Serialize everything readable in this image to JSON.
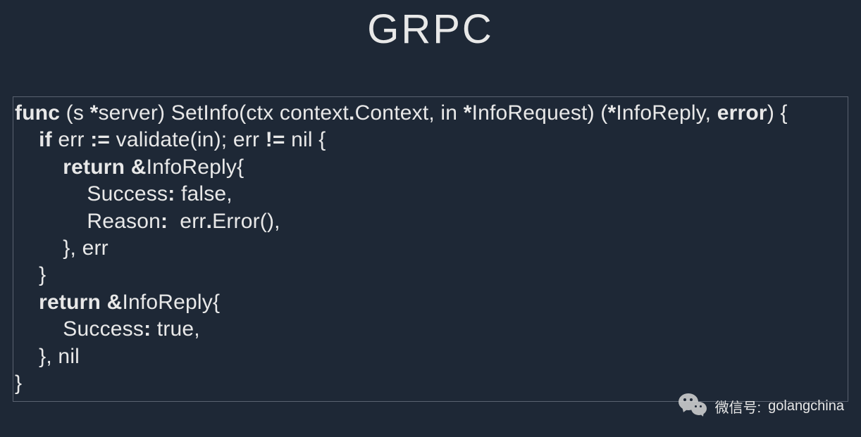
{
  "title": "GRPC",
  "code": {
    "line1": {
      "kw_func": "func",
      "receiver_open": " (s ",
      "star1": "*",
      "receiver_type": "server) SetInfo(ctx context",
      "dot1": ".",
      "context": "Context, in ",
      "star2": "*",
      "req": "InfoRequest) (",
      "star3": "*",
      "reply": "InfoReply, ",
      "kw_error": "error",
      "close": ") {"
    },
    "line2": {
      "indent": "    ",
      "kw_if": "if",
      "err": " err ",
      "op_assign": ":=",
      "validate": " validate(in); err ",
      "op_neq": "!=",
      "nil": " nil {"
    },
    "line3": {
      "indent": "        ",
      "kw_return": "return",
      "sp": " ",
      "amp": "&",
      "reply": "InfoReply{"
    },
    "line4": {
      "indent": "            Success",
      "colon": ":",
      "val": " false,"
    },
    "line5": {
      "indent": "            Reason",
      "colon": ":",
      "sp": "  err",
      "dot": ".",
      "call": "Error(),"
    },
    "line6": "        }, err",
    "line7": "    }",
    "line8": {
      "indent": "    ",
      "kw_return": "return",
      "sp": " ",
      "amp": "&",
      "reply": "InfoReply{"
    },
    "line9": {
      "indent": "        Success",
      "colon": ":",
      "val": " true,"
    },
    "line10": "    }, nil",
    "line11": "}"
  },
  "watermark": {
    "label": "微信号: ",
    "value": "golangchina"
  }
}
